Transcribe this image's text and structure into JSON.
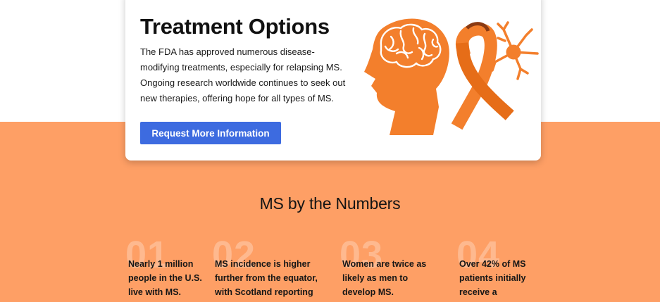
{
  "treatment": {
    "title": "Treatment Options",
    "body": "The FDA has approved numerous disease-modifying treatments, especially for relapsing MS. Ongoing research worldwide continues to seek out new therapies, offering hope for all types of MS.",
    "cta_label": "Request More Information",
    "illustration_icon": "brain-ribbon-neuron-icon"
  },
  "numbers": {
    "title": "MS by the Numbers",
    "items": [
      {
        "number": "01",
        "text": "Nearly 1 million people in the U.S. live with MS."
      },
      {
        "number": "02",
        "text": "MS incidence is higher further from the equator, with Scotland reporting the"
      },
      {
        "number": "03",
        "text": "Women are twice as likely as men to develop MS."
      },
      {
        "number": "04",
        "text": "Over 42% of MS patients initially receive a"
      }
    ]
  },
  "colors": {
    "accent_orange": "#fe9f65",
    "illustration_orange": "#f37f2c",
    "button_blue": "#3d6be0"
  }
}
